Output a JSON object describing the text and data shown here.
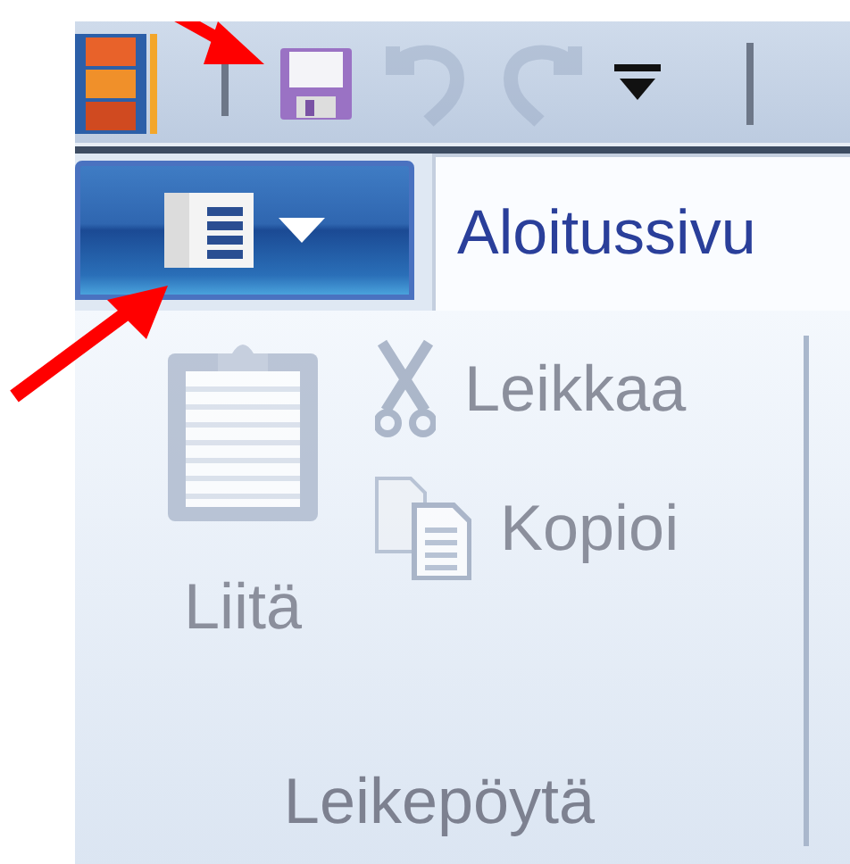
{
  "quick_access": [
    {
      "kind": "save",
      "disabled": false
    },
    {
      "kind": "undo",
      "disabled": true
    },
    {
      "kind": "redo",
      "disabled": true
    },
    {
      "kind": "customize",
      "disabled": false
    }
  ],
  "tabs": [
    {
      "label": "Aloitussivu",
      "selected": true
    }
  ],
  "ribbon_group": {
    "label": "Leikepöytä",
    "buttons": [
      {
        "kind": "paste",
        "label": "Liitä",
        "disabled": true
      },
      {
        "kind": "cut",
        "label": "Leikkaa",
        "disabled": true
      },
      {
        "kind": "copy",
        "label": "Kopioi",
        "disabled": true
      }
    ]
  }
}
